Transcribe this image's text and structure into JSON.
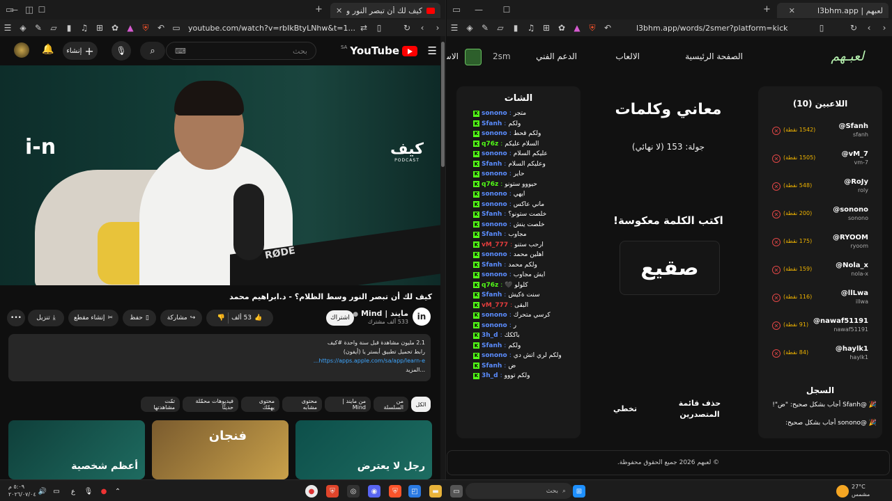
{
  "left_window": {
    "tabs": [
      {
        "title": "كيف لك أن تبصر النور وسط الظ"
      }
    ],
    "url": "youtube.com/watch?v=rbIkBtyLNhw&t=1...",
    "youtube": {
      "logo": "YouTube",
      "logo_country": "SA",
      "search_placeholder": "بحث",
      "create_label": "إنشاء",
      "video_brand_left": "i‑n",
      "video_brand_right": "كيف",
      "video_brand_right_sub": "PODCAST",
      "mic_brand": "RØDE",
      "video_title": "كيف لك أن تبصر النور وسط الظلام؟ - د.ابراهيم محمد",
      "channel_name": "مايند | Mind",
      "channel_subs": "533 ألف مشترك",
      "channel_avatar": "in",
      "subscribe": "اشتراك",
      "likes": "53 ألف",
      "share": "مشاركة",
      "save": "حفظ",
      "clip": "إنشاء مقطع",
      "download": "تنزيل",
      "description": {
        "line1": "2.1 مليون مشاهدة  قبل سنة واحدة  #كيف",
        "line2": "رابط تحميل تطبيق أبستر يا (أيفون)",
        "link": "https://apps.apple.com/sa/app/learn-e...",
        "more": "...المزيد"
      },
      "chips": [
        "الكل",
        "من السلسلة",
        "من مايند | Mind",
        "محتوى مشابه",
        "محتوى يهمّك",
        "فيديوهات محمّلة حديثًا",
        "تمّت مشاهدتها"
      ],
      "thumbs": [
        {
          "text": "رجل لا يعترض"
        },
        {
          "text": "فنجان"
        },
        {
          "text": "أعظم شخصية"
        }
      ]
    }
  },
  "right_window": {
    "tabs": [
      {
        "title": "لعبهم | l3bhm.app"
      }
    ],
    "url": "l3bhm.app/words/2smer?platform=kick",
    "site": {
      "logo": "لعبـهم",
      "nav": [
        "الصفحة الرئيسية",
        "الالعاب",
        "الدعم الفني",
        "الاس"
      ],
      "streamer": "2sm",
      "chat_title": "الشات",
      "chat": [
        {
          "user": "sonono",
          "msg": "متجر",
          "color": "#5b8dff"
        },
        {
          "user": "Sfanh",
          "msg": "ولكم",
          "color": "#5b8dff"
        },
        {
          "user": "sonono",
          "msg": "ولكم قحط",
          "color": "#5b8dff"
        },
        {
          "user": "q76z",
          "msg": "السلام عليكم",
          "color": "#53fc18"
        },
        {
          "user": "sonono",
          "msg": "عليكم السلام",
          "color": "#5b8dff"
        },
        {
          "user": "Sfanh",
          "msg": "وعليكم السلام",
          "color": "#5b8dff"
        },
        {
          "user": "sonono",
          "msg": "حاير",
          "color": "#5b8dff"
        },
        {
          "user": "q76z",
          "msg": "حيووو ستونو",
          "color": "#53fc18"
        },
        {
          "user": "sonono",
          "msg": "ايهي",
          "color": "#5b8dff"
        },
        {
          "user": "sonono",
          "msg": "ماني عاكس",
          "color": "#5b8dff"
        },
        {
          "user": "Sfanh",
          "msg": "خلصت ستونو؟",
          "color": "#5b8dff"
        },
        {
          "user": "sonono",
          "msg": "خلصت ينش",
          "color": "#5b8dff"
        },
        {
          "user": "Sfanh",
          "msg": "مجاوب",
          "color": "#5b8dff"
        },
        {
          "user": "vM_777",
          "msg": "ارحب ستنو",
          "color": "#e33c3c"
        },
        {
          "user": "sonono",
          "msg": "اهلين محمد",
          "color": "#5b8dff"
        },
        {
          "user": "Sfanh",
          "msg": "ولكم محمد",
          "color": "#5b8dff"
        },
        {
          "user": "sonono",
          "msg": "ايش مجاوب",
          "color": "#5b8dff"
        },
        {
          "user": "q76z",
          "msg": "كلولو 🖤",
          "color": "#53fc18"
        },
        {
          "user": "Sfanh",
          "msg": "سنت ةكيش",
          "color": "#5b8dff"
        },
        {
          "user": "vM_777",
          "msg": "البقى",
          "color": "#e33c3c"
        },
        {
          "user": "sonono",
          "msg": "كرسي متحرك",
          "color": "#5b8dff"
        },
        {
          "user": "sonono",
          "msg": "ر",
          "color": "#5b8dff"
        },
        {
          "user": "3h_d",
          "msg": "باككك",
          "color": "#5b8dff"
        },
        {
          "user": "Sfanh",
          "msg": "ولكم",
          "color": "#5b8dff"
        },
        {
          "user": "sonono",
          "msg": "ولكم لري اتش دي",
          "color": "#5b8dff"
        },
        {
          "user": "Sfanh",
          "msg": "ض",
          "color": "#5b8dff"
        },
        {
          "user": "3h_d",
          "msg": "ولكم تووو",
          "color": "#5b8dff"
        }
      ],
      "game_title": "معاني وكلمات",
      "round": "جولة: 153 (لا نهائي)",
      "instruction": "اكتب الكلمة معكوسة!",
      "word": "صقيع",
      "skip": "تخطي",
      "clear_leaderboard": "حذف قائمة المتصدرين",
      "players_title": "اللاعبين (10)",
      "players": [
        {
          "name": "@Sfanh",
          "handle": "sfanh",
          "points": "(1542 نقطة)"
        },
        {
          "name": "@vM_7",
          "handle": "vm-7",
          "points": "(1505 نقطة)"
        },
        {
          "name": "@RoJy",
          "handle": "roly",
          "points": "(548 نقطة)"
        },
        {
          "name": "@sonono",
          "handle": "sonono",
          "points": "(200 نقطة)"
        },
        {
          "name": "@RYOOM",
          "handle": "ryoom",
          "points": "(175 نقطة)"
        },
        {
          "name": "@Nola_x",
          "handle": "nola-x",
          "points": "(159 نقطة)"
        },
        {
          "name": "@llLwa",
          "handle": "illwa",
          "points": "(116 نقطة)"
        },
        {
          "name": "@nawaf51191",
          "handle": "nawaf51191",
          "points": "(91 نقطة)"
        },
        {
          "name": "@haylk1",
          "handle": "haylk1",
          "points": "(84 نقطة)"
        }
      ],
      "log_title": "السجل",
      "log": [
        "🎉 @Sfanh أجاب بشكل صحيح: \"ض\"!",
        "🎉 @sonono أجاب بشكل صحيح:"
      ],
      "footer": "© لعبهم 2026 جميع الحقوق محفوظة."
    }
  },
  "taskbar": {
    "search": "بحث",
    "clock_time": "٥:٠٩ م",
    "clock_date": "٢٠٢٦/٠٧/٠٤",
    "temp": "27°C",
    "weather": "مشمس",
    "lang": "ع"
  }
}
